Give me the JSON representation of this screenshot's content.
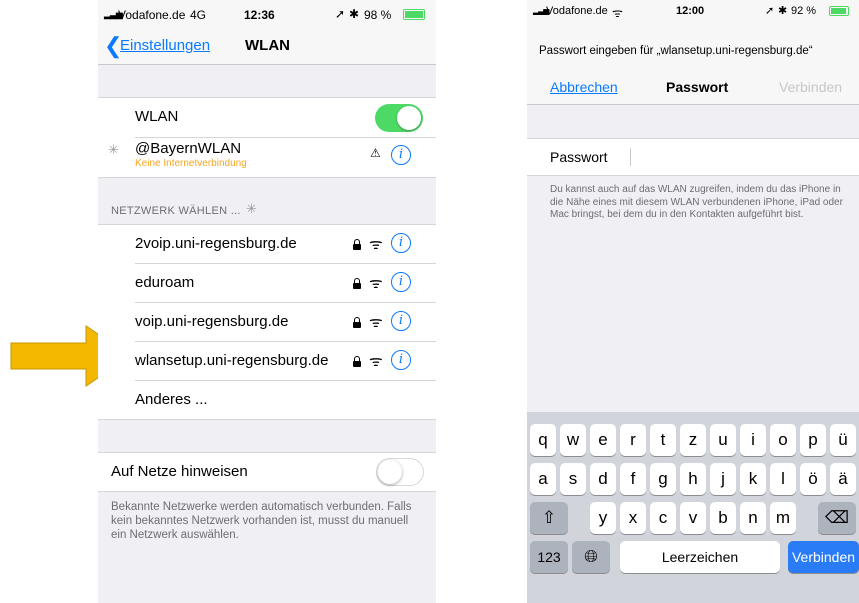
{
  "left_phone": {
    "status": {
      "carrier": "Vodafone.de",
      "network": "4G",
      "time": "12:36",
      "battery": "98 %"
    },
    "nav": {
      "back_label": "Einstellungen",
      "title": "WLAN"
    },
    "wlan_row": {
      "label": "WLAN",
      "toggle_on": true
    },
    "connected": {
      "name": "@BayernWLAN",
      "status": "Keine Internetverbindung"
    },
    "section_header": "NETZWERK WÄHLEN ...",
    "networks": [
      {
        "name": "2voip.uni-regensburg.de",
        "secured": true
      },
      {
        "name": "eduroam",
        "secured": true
      },
      {
        "name": "voip.uni-regensburg.de",
        "secured": true
      },
      {
        "name": "wlansetup.uni-regensburg.de",
        "secured": true
      }
    ],
    "other_label": "Anderes ...",
    "ask_row": {
      "label": "Auf Netze hinweisen",
      "toggle_on": false
    },
    "footer": "Bekannte Netzwerke werden automatisch verbunden. Falls kein bekanntes Netzwerk vorhanden ist, musst du manuell ein Netzwerk auswählen."
  },
  "right_phone": {
    "status": {
      "carrier": "Vodafone.de",
      "time": "12:00",
      "battery": "92 %"
    },
    "prompt": "Passwort eingeben für „wlansetup.uni-regensburg.de“",
    "nav": {
      "cancel_label": "Abbrechen",
      "title": "Passwort",
      "connect_label": "Verbinden"
    },
    "password_label": "Passwort",
    "hint": "Du kannst auch auf das WLAN zugreifen, indem du das iPhone in die Nähe eines mit diesem WLAN verbundenen iPhone, iPad oder Mac bringst, bei dem du in den Kontakten aufgeführt bist.",
    "keyboard": {
      "row1": [
        "q",
        "w",
        "e",
        "r",
        "t",
        "z",
        "u",
        "i",
        "o",
        "p",
        "ü"
      ],
      "row2": [
        "a",
        "s",
        "d",
        "f",
        "g",
        "h",
        "j",
        "k",
        "l",
        "ö",
        "ä"
      ],
      "row3": [
        "y",
        "x",
        "c",
        "v",
        "b",
        "n",
        "m"
      ],
      "numbers_key": "123",
      "space_key": "Leerzeichen",
      "return_key": "Verbinden"
    }
  },
  "colors": {
    "ios_blue": "#0a7aff",
    "toggle_green": "#4cd964",
    "arrow_fill": "#f5b800",
    "warning_orange": "#f5a623"
  }
}
